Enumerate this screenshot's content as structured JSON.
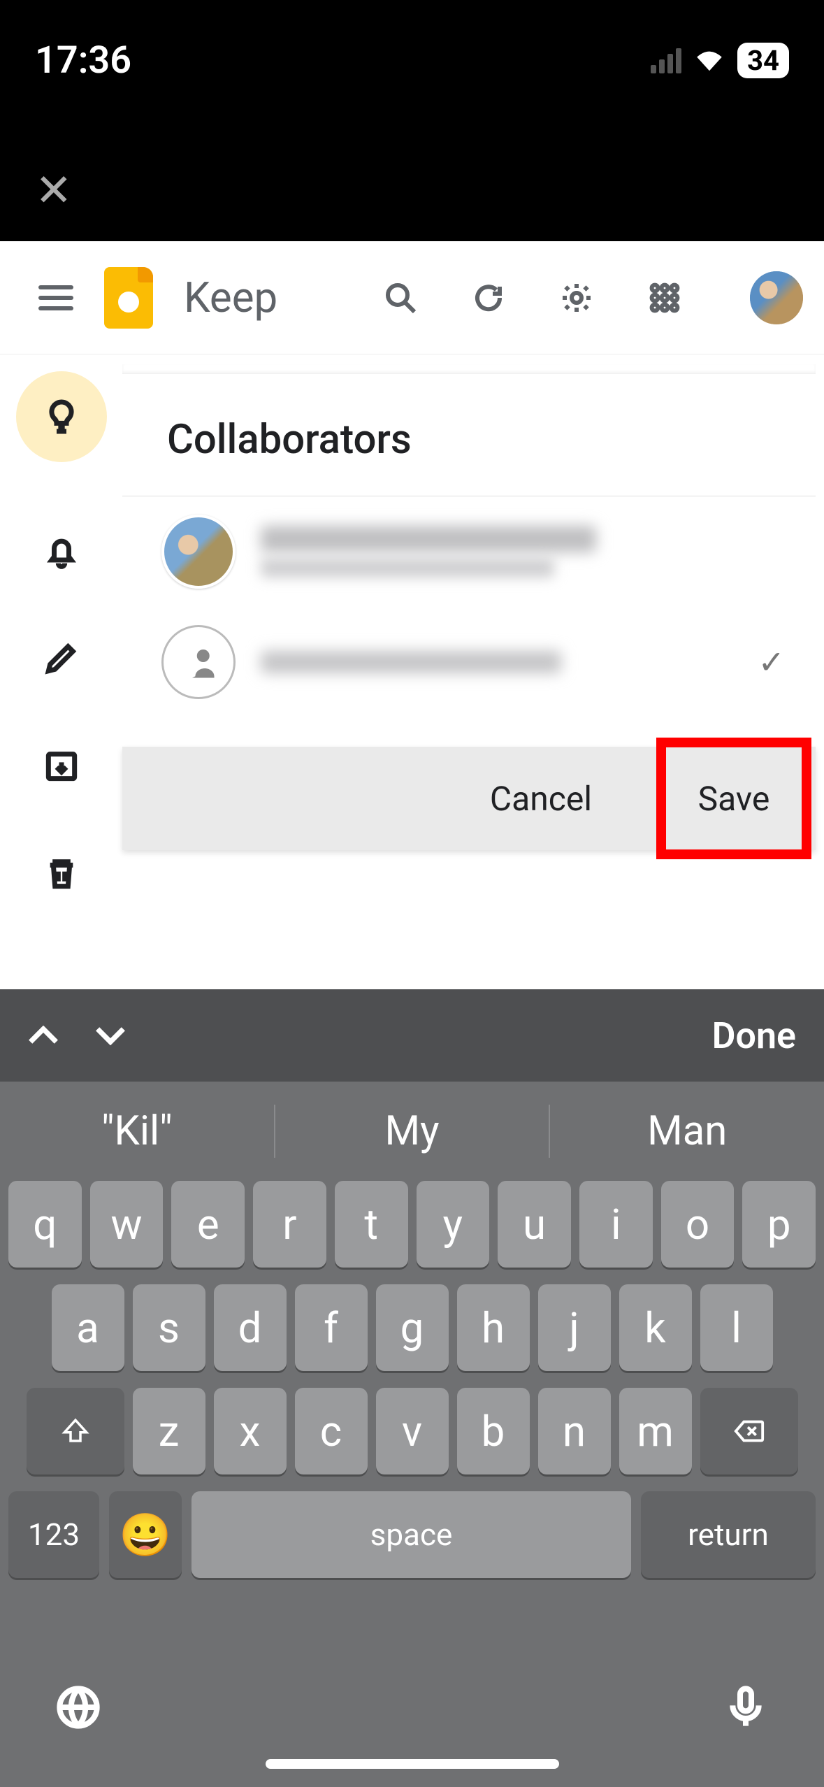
{
  "status": {
    "time": "17:36",
    "battery": "34"
  },
  "header": {
    "app_name": "Keep"
  },
  "panel": {
    "title": "Collaborators"
  },
  "actions": {
    "cancel": "Cancel",
    "save": "Save"
  },
  "keyboard": {
    "done": "Done",
    "suggestions": [
      "\"Kil\"",
      "My",
      "Man"
    ],
    "row1": [
      "q",
      "w",
      "e",
      "r",
      "t",
      "y",
      "u",
      "i",
      "o",
      "p"
    ],
    "row2": [
      "a",
      "s",
      "d",
      "f",
      "g",
      "h",
      "j",
      "k",
      "l"
    ],
    "row3": [
      "z",
      "x",
      "c",
      "v",
      "b",
      "n",
      "m"
    ],
    "numeric": "123",
    "space": "space",
    "return": "return"
  }
}
